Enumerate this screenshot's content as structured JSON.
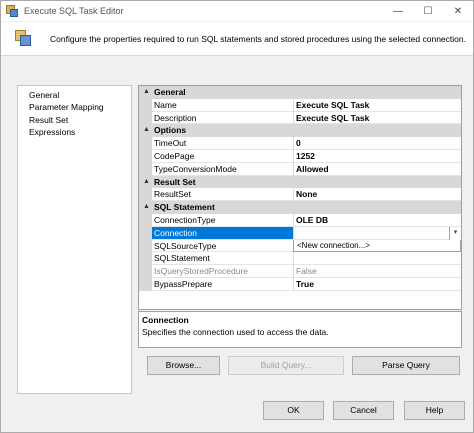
{
  "window": {
    "title": "Execute SQL Task Editor",
    "controls": {
      "minimize": "—",
      "maximize": "☐",
      "close": "✕"
    }
  },
  "header": {
    "description": "Configure the properties required to run SQL statements and stored procedures using the selected connection."
  },
  "nav": {
    "items": [
      {
        "label": "General"
      },
      {
        "label": "Parameter Mapping"
      },
      {
        "label": "Result Set"
      },
      {
        "label": "Expressions"
      }
    ]
  },
  "grid": {
    "collapse_glyph": "▲",
    "categories": {
      "general": "General",
      "options": "Options",
      "result_set": "Result Set",
      "sql_statement": "SQL Statement"
    },
    "props": {
      "name": {
        "label": "Name",
        "value": "Execute SQL Task"
      },
      "description": {
        "label": "Description",
        "value": "Execute SQL Task"
      },
      "timeout": {
        "label": "TimeOut",
        "value": "0"
      },
      "codepage": {
        "label": "CodePage",
        "value": "1252"
      },
      "typeconv": {
        "label": "TypeConversionMode",
        "value": "Allowed"
      },
      "resultset": {
        "label": "ResultSet",
        "value": "None"
      },
      "conntype": {
        "label": "ConnectionType",
        "value": "OLE DB"
      },
      "connection": {
        "label": "Connection",
        "value": ""
      },
      "sqlsource": {
        "label": "SQLSourceType",
        "value": ""
      },
      "sqlstatement": {
        "label": "SQLStatement",
        "value": ""
      },
      "isquery": {
        "label": "IsQueryStoredProcedure",
        "value": "False"
      },
      "bypass": {
        "label": "BypassPrepare",
        "value": "True"
      }
    },
    "dropdown_arrow": "▾",
    "dropdown_option": "<New connection...>"
  },
  "description_panel": {
    "title": "Connection",
    "text": "Specifies the connection used to access the data."
  },
  "buttons": {
    "browse": "Browse...",
    "build_query": "Build Query...",
    "parse_query": "Parse Query",
    "ok": "OK",
    "cancel": "Cancel",
    "help": "Help"
  },
  "colors": {
    "selection": "#0078d7",
    "category_band": "#d8d8d8"
  }
}
